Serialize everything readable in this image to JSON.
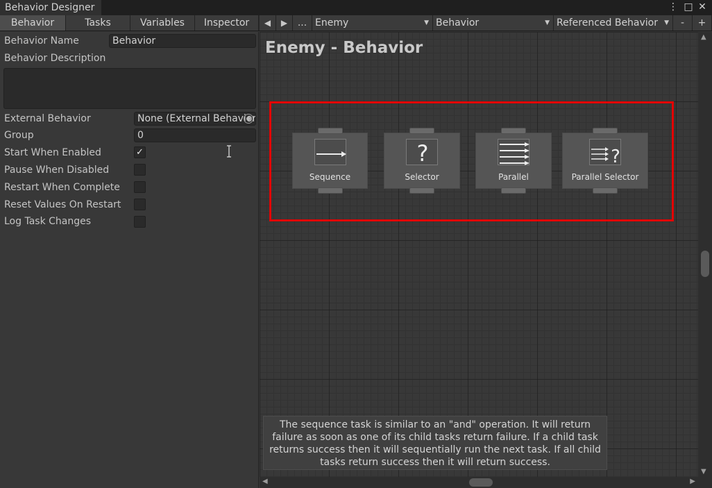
{
  "window": {
    "title": "Behavior Designer",
    "menu_glyph": "⋮",
    "maximize_glyph": "□",
    "close_glyph": "✕"
  },
  "toolbar": {
    "tabs": [
      {
        "label": "Behavior",
        "active": true
      },
      {
        "label": "Tasks",
        "active": false
      },
      {
        "label": "Variables",
        "active": false
      },
      {
        "label": "Inspector",
        "active": false
      }
    ],
    "back_glyph": "◀",
    "forward_glyph": "▶",
    "more_label": "...",
    "object_dropdown": "Enemy",
    "behavior_dropdown": "Behavior",
    "referenced_dropdown": "Referenced Behavior",
    "remove_label": "-",
    "add_label": "+"
  },
  "inspector": {
    "behavior_name_label": "Behavior Name",
    "behavior_name_value": "Behavior",
    "description_label": "Behavior Description",
    "description_value": "",
    "external_behavior_label": "External Behavior",
    "external_behavior_value": "None (External Behavior)",
    "group_label": "Group",
    "group_value": "0",
    "checkboxes": [
      {
        "label": "Start When Enabled",
        "checked": true
      },
      {
        "label": "Pause When Disabled",
        "checked": false
      },
      {
        "label": "Restart When Complete",
        "checked": false
      },
      {
        "label": "Reset Values On Restart",
        "checked": false
      },
      {
        "label": "Log Task Changes",
        "checked": false
      }
    ]
  },
  "graph": {
    "title": "Enemy - Behavior",
    "highlight_color": "#e30000",
    "nodes": [
      {
        "label": "Sequence",
        "icon": "sequence-arrow-icon"
      },
      {
        "label": "Selector",
        "icon": "question-mark-icon"
      },
      {
        "label": "Parallel",
        "icon": "parallel-arrows-icon"
      },
      {
        "label": "Parallel Selector",
        "icon": "parallel-selector-icon"
      }
    ],
    "description": "The sequence task is similar to an \"and\" operation. It will return failure as soon as one of its child tasks return failure. If a child task returns success then it will sequentially run the next task. If all child tasks return success then it will return success."
  }
}
